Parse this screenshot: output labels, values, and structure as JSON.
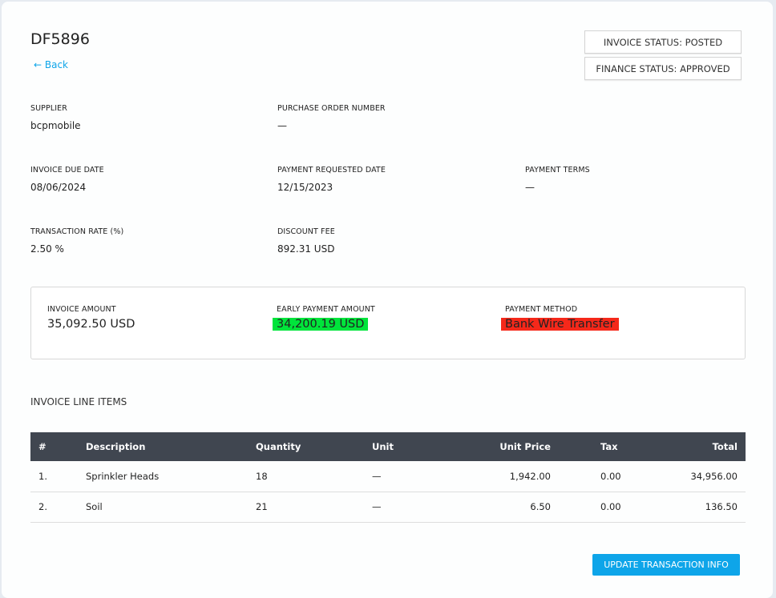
{
  "header": {
    "title": "DF5896",
    "back": "← Back",
    "invoice_status": "INVOICE STATUS: POSTED",
    "finance_status": "FINANCE STATUS: APPROVED"
  },
  "fields": {
    "supplier": {
      "label": "SUPPLIER",
      "value": "bcpmobile"
    },
    "po": {
      "label": "PURCHASE ORDER NUMBER",
      "value": "—"
    },
    "due": {
      "label": "INVOICE DUE DATE",
      "value": "08/06/2024"
    },
    "requested": {
      "label": "PAYMENT REQUESTED DATE",
      "value": "12/15/2023"
    },
    "terms": {
      "label": "PAYMENT TERMS",
      "value": "—"
    },
    "rate": {
      "label": "TRANSACTION RATE (%)",
      "value": "2.50 %"
    },
    "fee": {
      "label": "DISCOUNT FEE",
      "value": "892.31 USD"
    }
  },
  "summary": {
    "invoice_amount": {
      "label": "INVOICE AMOUNT",
      "value": "35,092.50 USD"
    },
    "early_payment": {
      "label": "EARLY PAYMENT AMOUNT",
      "value": "34,200.19 USD",
      "color": "#00e43b"
    },
    "method": {
      "label": "PAYMENT METHOD",
      "value": "Bank Wire Transfer",
      "color": "#f5281a"
    }
  },
  "line_items": {
    "title": "INVOICE LINE ITEMS",
    "headers": [
      "#",
      "Description",
      "Quantity",
      "Unit",
      "Unit Price",
      "Tax",
      "Total"
    ],
    "rows": [
      [
        "1.",
        "Sprinkler Heads",
        "18",
        "—",
        "1,942.00",
        "0.00",
        "34,956.00"
      ],
      [
        "2.",
        "Soil",
        "21",
        "—",
        "6.50",
        "0.00",
        "136.50"
      ]
    ]
  },
  "update_button": "UPDATE TRANSACTION INFO"
}
